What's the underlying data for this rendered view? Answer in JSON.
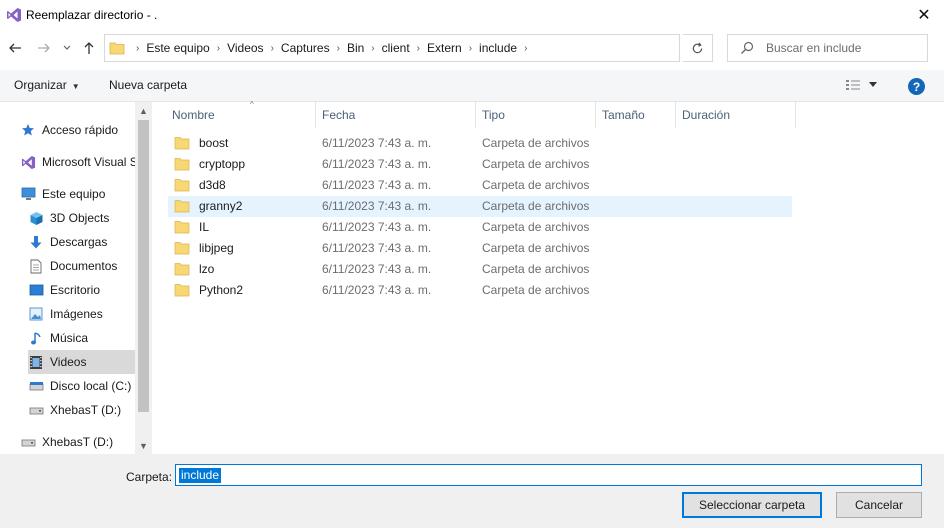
{
  "window": {
    "title": "Reemplazar directorio - .",
    "close_glyph": "✕",
    "logo": "visual-studio-icon"
  },
  "address": {
    "breadcrumbs": [
      "Este equipo",
      "Videos",
      "Captures",
      "Bin",
      "client",
      "Extern",
      "include"
    ],
    "search_placeholder": "Buscar en include"
  },
  "toolbar": {
    "organize_label": "Organizar",
    "new_folder_label": "Nueva carpeta",
    "help_label": "?"
  },
  "nav": {
    "items": [
      {
        "label": "Acceso rápido",
        "icon": "star-icon"
      },
      {
        "label": "Microsoft Visual S",
        "icon": "visual-studio-icon"
      },
      {
        "label": "Este equipo",
        "icon": "computer-icon"
      },
      {
        "label": "3D Objects",
        "icon": "cube-icon"
      },
      {
        "label": "Descargas",
        "icon": "download-icon"
      },
      {
        "label": "Documentos",
        "icon": "document-icon"
      },
      {
        "label": "Escritorio",
        "icon": "desktop-icon"
      },
      {
        "label": "Imágenes",
        "icon": "image-icon"
      },
      {
        "label": "Música",
        "icon": "music-icon"
      },
      {
        "label": "Videos",
        "icon": "video-icon",
        "selected": true
      },
      {
        "label": "Disco local (C:)",
        "icon": "drive-icon"
      },
      {
        "label": "XhebasT (D:)",
        "icon": "drive-icon"
      },
      {
        "label": "XhebasT (D:)",
        "icon": "drive-icon"
      }
    ]
  },
  "columns": {
    "name": "Nombre",
    "date": "Fecha",
    "type": "Tipo",
    "size": "Tamaño",
    "duration": "Duración"
  },
  "files": [
    {
      "name": "boost",
      "date": "6/11/2023 7:43 a. m.",
      "type": "Carpeta de archivos"
    },
    {
      "name": "cryptopp",
      "date": "6/11/2023 7:43 a. m.",
      "type": "Carpeta de archivos"
    },
    {
      "name": "d3d8",
      "date": "6/11/2023 7:43 a. m.",
      "type": "Carpeta de archivos"
    },
    {
      "name": "granny2",
      "date": "6/11/2023 7:43 a. m.",
      "type": "Carpeta de archivos",
      "highlighted": true
    },
    {
      "name": "IL",
      "date": "6/11/2023 7:43 a. m.",
      "type": "Carpeta de archivos"
    },
    {
      "name": "libjpeg",
      "date": "6/11/2023 7:43 a. m.",
      "type": "Carpeta de archivos"
    },
    {
      "name": "lzo",
      "date": "6/11/2023 7:43 a. m.",
      "type": "Carpeta de archivos"
    },
    {
      "name": "Python2",
      "date": "6/11/2023 7:43 a. m.",
      "type": "Carpeta de archivos"
    }
  ],
  "footer": {
    "folder_label": "Carpeta:",
    "folder_value": "include",
    "select_button": "Seleccionar carpeta",
    "cancel_button": "Cancelar"
  },
  "colors": {
    "accent": "#0078d7",
    "folder_yellow": "#f8d775",
    "selected_nav": "#d9d9d9",
    "hover_row": "#e5f3ff"
  }
}
